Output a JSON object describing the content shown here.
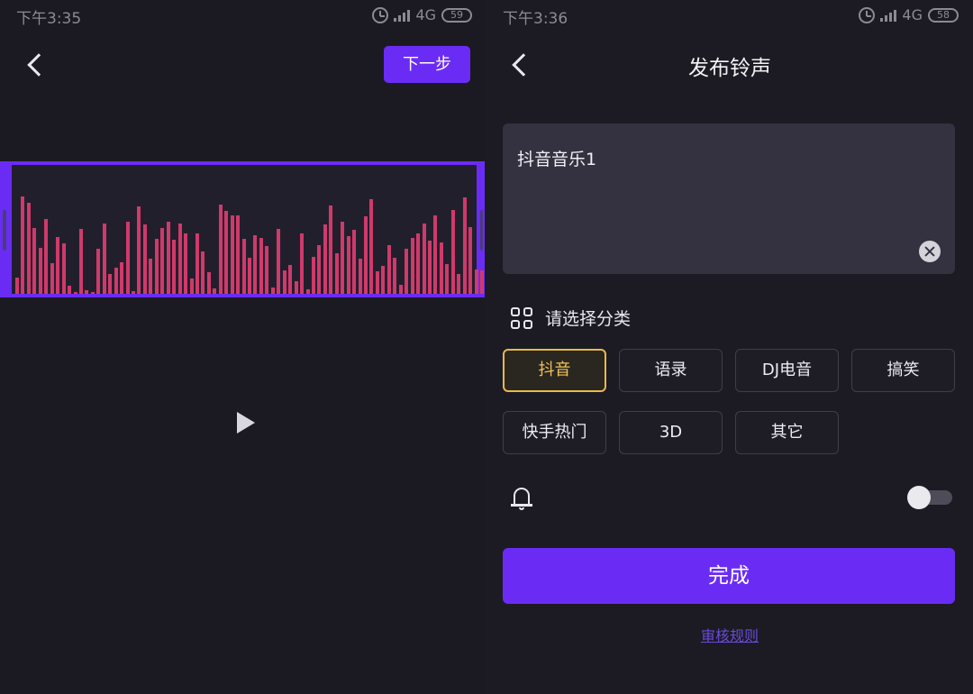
{
  "left_screen": {
    "status": {
      "time": "下午3:35",
      "network": "4G",
      "battery": "59"
    },
    "next_button_label": "下一步",
    "waveform_bars": [
      18,
      108,
      101,
      73,
      51,
      83,
      34,
      63,
      56,
      9,
      0,
      72,
      4,
      0,
      50,
      78,
      22,
      29,
      35,
      80,
      3,
      97,
      77,
      39,
      61,
      73,
      80,
      60,
      78,
      67,
      17,
      67,
      47,
      24,
      6,
      99,
      92,
      87,
      87,
      61,
      40,
      65,
      62,
      53,
      7,
      72,
      26,
      32,
      14,
      67,
      5,
      41,
      54,
      77,
      98,
      45,
      80,
      64,
      71,
      39,
      86,
      105,
      25,
      31,
      54,
      40,
      10,
      50,
      62,
      67,
      78,
      59,
      87,
      57,
      33,
      93,
      22,
      107,
      74,
      27,
      26
    ],
    "play_icon": "play-icon"
  },
  "right_screen": {
    "status": {
      "time": "下午3:36",
      "network": "4G",
      "battery": "58"
    },
    "title": "发布铃声",
    "name_field_value": "抖音音乐1",
    "category_label": "请选择分类",
    "categories": [
      "抖音",
      "语录",
      "DJ电音",
      "搞笑",
      "快手热门",
      "3D",
      "其它"
    ],
    "selected_category": "抖音",
    "ringtone_toggle": false,
    "done_button_label": "完成",
    "review_link": "审核规则",
    "colors": {
      "accent": "#6a2cf5",
      "selected": "#e8b94a",
      "wave": "#cf3a6a"
    }
  }
}
